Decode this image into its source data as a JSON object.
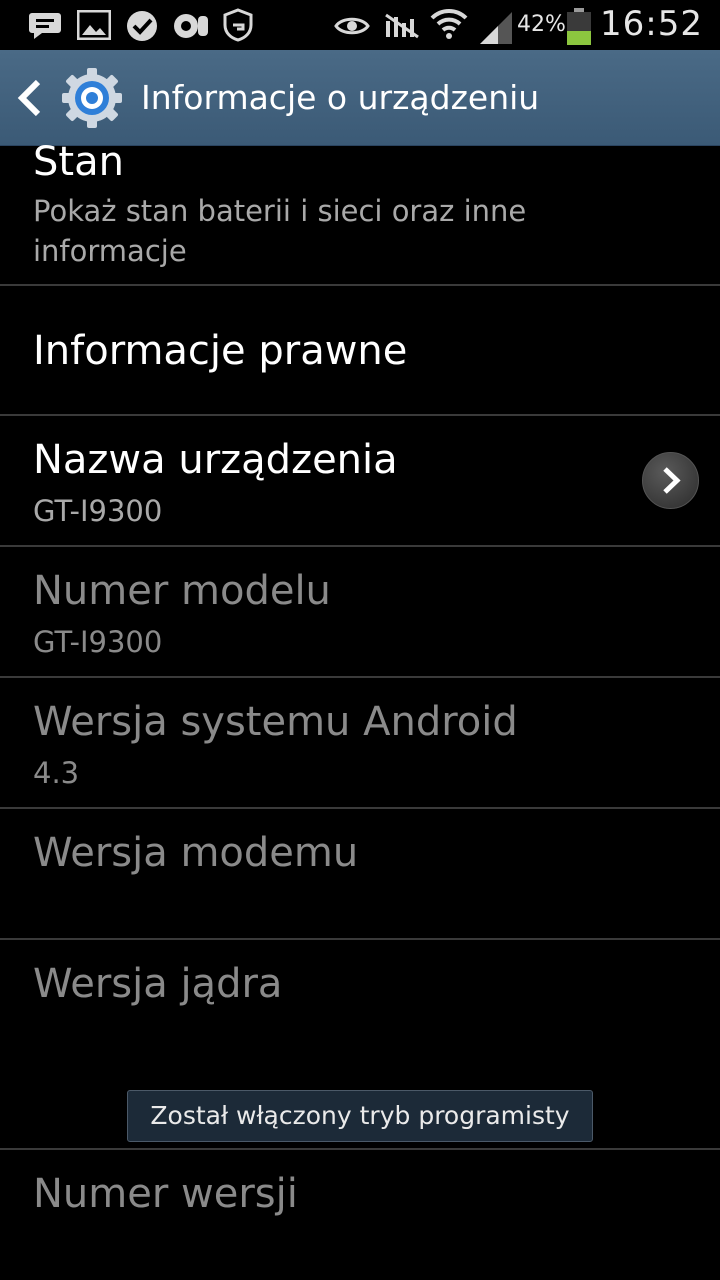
{
  "status_bar": {
    "battery_percent": "42%",
    "battery_level": 0.42,
    "time": "16:52",
    "left_icons": [
      "message-icon",
      "image-icon",
      "check-icon",
      "voicemail-icon",
      "shield-icon"
    ],
    "right_icons": [
      "eye-icon",
      "no-signal-icon",
      "wifi-icon",
      "signal-icon",
      "battery-icon"
    ]
  },
  "action_bar": {
    "title": "Informacje o urządzeniu",
    "icon": "settings-gear-icon"
  },
  "list": {
    "items": [
      {
        "title": "Stan",
        "subtitle": "Pokaż stan baterii i sieci oraz inne",
        "subtitle2": "informacje"
      },
      {
        "title": "Informacje prawne"
      },
      {
        "title": "Nazwa urządzenia",
        "subtitle": "GT-I9300"
      },
      {
        "title": "Numer modelu",
        "subtitle": "GT-I9300"
      },
      {
        "title": "Wersja systemu Android",
        "subtitle": "4.3"
      },
      {
        "title": "Wersja modemu"
      },
      {
        "title": "Wersja jądra"
      },
      {
        "title": "Numer wersji"
      }
    ]
  },
  "toast": {
    "text": "Został włączony tryb programisty"
  }
}
